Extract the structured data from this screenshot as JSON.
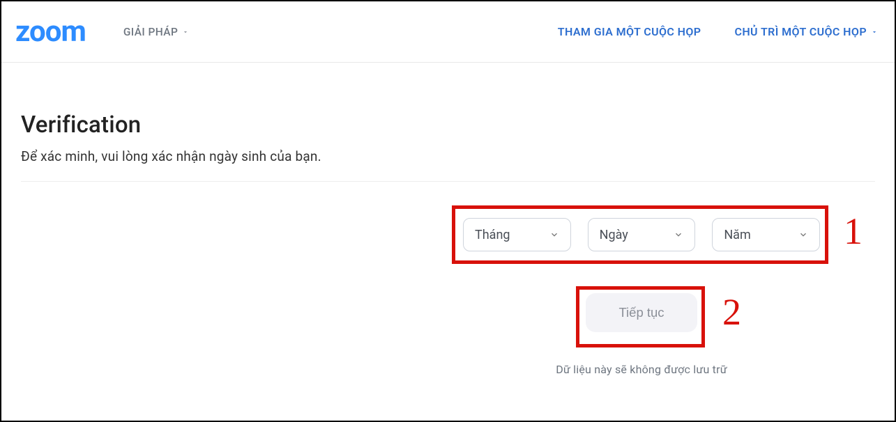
{
  "header": {
    "logo": "zoom",
    "nav_left": {
      "solutions": "GIẢI PHÁP"
    },
    "nav_right": {
      "join": "THAM GIA MỘT CUỘC HỌP",
      "host": "CHỦ TRÌ MỘT CUỘC HỌP"
    }
  },
  "page": {
    "title": "Verification",
    "subtitle": "Để xác minh, vui lòng xác nhận ngày sinh của bạn.",
    "note": "Dữ liệu này sẽ không được lưu trữ"
  },
  "form": {
    "month_label": "Tháng",
    "day_label": "Ngày",
    "year_label": "Năm",
    "continue_label": "Tiếp tục"
  },
  "annotations": {
    "one": "1",
    "two": "2"
  },
  "colors": {
    "brand_blue": "#2d8cff",
    "link_blue": "#2d6ecf",
    "highlight_red": "#d8110a"
  }
}
